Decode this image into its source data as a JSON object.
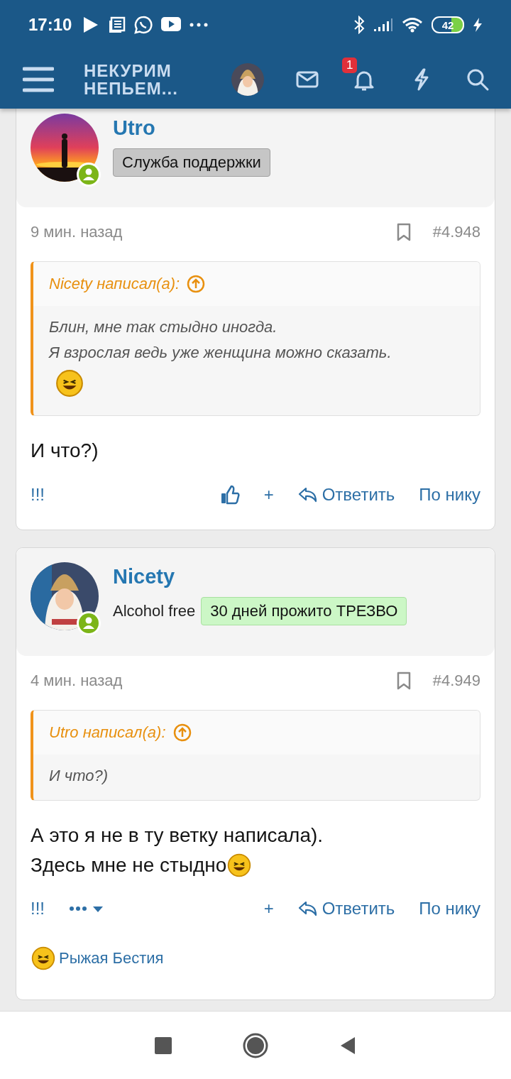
{
  "status_bar": {
    "time": "17:10",
    "battery": "42"
  },
  "header": {
    "logo_lines": [
      "НЕКУРИМ",
      "НЕПЬЕМ..."
    ],
    "notification_count": "1"
  },
  "posts": [
    {
      "author": "Utro",
      "banner": {
        "text": "Служба поддержки",
        "kind": "staff"
      },
      "online": true,
      "time": "9 мин. назад",
      "post_number": "#4.948",
      "bookmarked": false,
      "quote": {
        "label": "Nicety написал(а):",
        "content": [
          {
            "kind": "text",
            "text": "Блин, мне так стыдно иногда."
          },
          {
            "kind": "text",
            "text": "Я взрослая ведь уже женщина можно сказать."
          },
          {
            "kind": "smiley"
          }
        ]
      },
      "body": [
        {
          "kind": "text",
          "text": "И что?)",
          "smiley": false
        }
      ],
      "actions_left": [
        {
          "kind": "label",
          "text": "!!!"
        }
      ],
      "actions_right": [
        {
          "kind": "like"
        },
        {
          "kind": "label",
          "text": "+"
        },
        {
          "kind": "reply",
          "text": "Ответить"
        },
        {
          "kind": "label",
          "text": "По нику"
        }
      ]
    },
    {
      "author": "Nicety",
      "user_title": "Alcohol free",
      "banner": {
        "text": "30 дней прожито ТРЕЗВО",
        "kind": "award"
      },
      "online": true,
      "time": "4 мин. назад",
      "post_number": "#4.949",
      "bookmarked": false,
      "quote": {
        "label": "Utro написал(а):",
        "content": [
          {
            "kind": "text",
            "text": "И что?)"
          }
        ]
      },
      "body": [
        {
          "kind": "text",
          "text": "А это я не в ту ветку написала).",
          "smiley": false
        },
        {
          "kind": "text",
          "text": "Здесь мне не стыдно",
          "smiley": true
        }
      ],
      "actions_left": [
        {
          "kind": "label",
          "text": "!!!"
        },
        {
          "kind": "more"
        }
      ],
      "actions_right": [
        {
          "kind": "label",
          "text": "+"
        },
        {
          "kind": "reply",
          "text": "Ответить"
        },
        {
          "kind": "label",
          "text": "По нику"
        }
      ],
      "reactions": {
        "names": "Рыжая Бестия"
      }
    }
  ]
}
